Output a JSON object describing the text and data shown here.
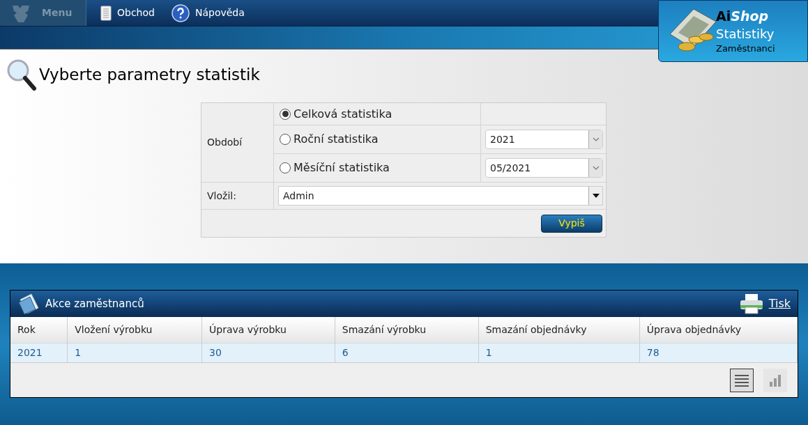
{
  "menu": {
    "label": "Menu",
    "items": [
      {
        "label": "Obchod",
        "kind": "document"
      },
      {
        "label": "Nápověda",
        "kind": "help"
      }
    ]
  },
  "logo": {
    "brand_bold": "Ai",
    "brand_italic": "Shop",
    "title": "Statistiky",
    "subtitle": "Zaměstnanci"
  },
  "page_title": "Vyberte parametry statistik",
  "form": {
    "period_label": "Období",
    "periods": [
      {
        "label": "Celková statistika",
        "selected": true
      },
      {
        "label": "Roční statistika",
        "selected": false,
        "value": "2021"
      },
      {
        "label": "Měsíční statistika",
        "selected": false,
        "value": "05/2021"
      }
    ],
    "inserted_by_label": "Vložil:",
    "inserted_by": "Admin",
    "submit": "Vypiš"
  },
  "panel": {
    "title": "Akce zaměstnanců",
    "print": "Tisk",
    "columns": [
      "Rok",
      "Vložení výrobku",
      "Úprava výrobku",
      "Smazání výrobku",
      "Smazání objednávky",
      "Úprava objednávky"
    ],
    "rows": [
      [
        "2021",
        "1",
        "30",
        "6",
        "1",
        "78"
      ]
    ],
    "views": [
      {
        "kind": "list",
        "selected": true
      },
      {
        "kind": "chart",
        "selected": false
      }
    ]
  }
}
